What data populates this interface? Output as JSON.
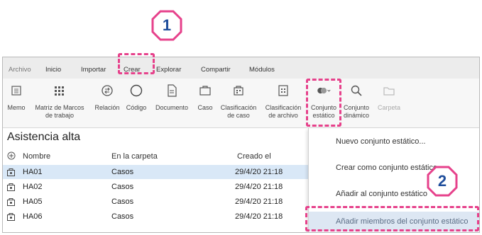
{
  "callouts": [
    {
      "label": "1"
    },
    {
      "label": "2"
    }
  ],
  "colors": {
    "accent_pink": "#e6418b",
    "badge_text": "#1f4e9c",
    "selection": "#d9e8f7",
    "hover": "#dde7f3"
  },
  "menubar": {
    "items": [
      "Archivo",
      "Inicio",
      "Importar",
      "Crear",
      "Explorar",
      "Compartir",
      "Módulos"
    ]
  },
  "ribbon": {
    "buttons": [
      {
        "label1": "Memo",
        "label2": "",
        "icon": "memo-icon"
      },
      {
        "label1": "Matriz de Marcos",
        "label2": "de trabajo",
        "icon": "grid-matrix-icon"
      },
      {
        "label1": "Relación",
        "label2": "",
        "icon": "relation-icon"
      },
      {
        "label1": "Código",
        "label2": "",
        "icon": "code-circle-icon"
      },
      {
        "label1": "Documento",
        "label2": "",
        "icon": "document-icon"
      },
      {
        "label1": "Caso",
        "label2": "",
        "icon": "case-icon"
      },
      {
        "label1": "Clasificación",
        "label2": "de caso",
        "icon": "case-classification-icon"
      },
      {
        "label1": "Clasificación",
        "label2": "de archivo",
        "icon": "file-classification-icon"
      },
      {
        "label1": "Conjunto",
        "label2": "estático",
        "icon": "static-set-icon"
      },
      {
        "label1": "Conjunto",
        "label2": "dinámico",
        "icon": "dynamic-set-search-icon"
      },
      {
        "label1": "Carpeta",
        "label2": "",
        "icon": "folder-icon"
      }
    ]
  },
  "content": {
    "title": "Asistencia alta",
    "columns": [
      "Nombre",
      "En la carpeta",
      "Creado el"
    ],
    "rows": [
      {
        "name": "HA01",
        "folder": "Casos",
        "created": "29/4/20 21:18"
      },
      {
        "name": "HA02",
        "folder": "Casos",
        "created": "29/4/20 21:18"
      },
      {
        "name": "HA05",
        "folder": "Casos",
        "created": "29/4/20 21:18"
      },
      {
        "name": "HA06",
        "folder": "Casos",
        "created": "29/4/20 21:18"
      }
    ]
  },
  "dropdown": {
    "items": [
      "Nuevo conjunto estático...",
      "Crear como conjunto estático",
      "Añadir al conjunto estático",
      "Añadir miembros del conjunto estático"
    ]
  }
}
